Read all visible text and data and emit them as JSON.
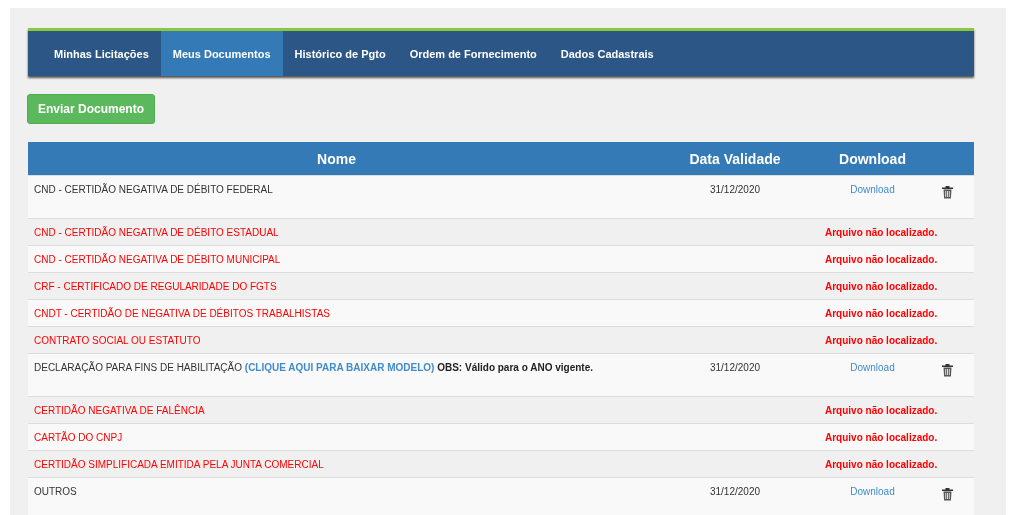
{
  "tabs": [
    {
      "label": "Minhas Licitações",
      "selected": false
    },
    {
      "label": "Meus Documentos",
      "selected": true
    },
    {
      "label": "Histórico de Pgto",
      "selected": false
    },
    {
      "label": "Ordem de Fornecimento",
      "selected": false
    },
    {
      "label": "Dados Cadastrais",
      "selected": false
    }
  ],
  "send_button": "Enviar Documento",
  "table": {
    "columns": [
      "Nome",
      "Data Validade",
      "Download"
    ],
    "rows": [
      {
        "kind": "file",
        "name": "CND - CERTIDÃO NEGATIVA DE DÉBITO FEDERAL",
        "date": "31/12/2020",
        "download": "Download"
      },
      {
        "kind": "missing",
        "name": "CND - CERTIDÃO NEGATIVA DE DÉBITO ESTADUAL",
        "status": "Arquivo não localizado."
      },
      {
        "kind": "missing",
        "name": "CND - CERTIDÃO NEGATIVA DE DÉBITO MUNICIPAL",
        "status": "Arquivo não localizado."
      },
      {
        "kind": "missing",
        "name": "CRF - CERTIFICADO DE REGULARIDADE DO FGTS",
        "status": "Arquivo não localizado."
      },
      {
        "kind": "missing",
        "name": "CNDT - CERTIDÃO DE NEGATIVA DE DÉBITOS TRABALHISTAS",
        "status": "Arquivo não localizado."
      },
      {
        "kind": "missing",
        "name": "CONTRATO SOCIAL OU ESTATUTO",
        "status": "Arquivo não localizado."
      },
      {
        "kind": "file",
        "name": "DECLARAÇÃO PARA FINS DE HABILITAÇÃO",
        "link": "(CLIQUE AQUI PARA BAIXAR MODELO)",
        "note": "OBS: Válido para o ANO vigente.",
        "date": "31/12/2020",
        "download": "Download"
      },
      {
        "kind": "missing",
        "name": "CERTIDÃO NEGATIVA DE FALÊNCIA",
        "status": "Arquivo não localizado."
      },
      {
        "kind": "missing",
        "name": "CARTÃO DO CNPJ",
        "status": "Arquivo não localizado."
      },
      {
        "kind": "missing",
        "name": "CERTIDÃO SIMPLIFICADA EMITIDA PELA JUNTA COMERCIAL",
        "status": "Arquivo não localizado."
      },
      {
        "kind": "file",
        "name": "OUTROS",
        "date": "31/12/2020",
        "download": "Download"
      }
    ]
  }
}
